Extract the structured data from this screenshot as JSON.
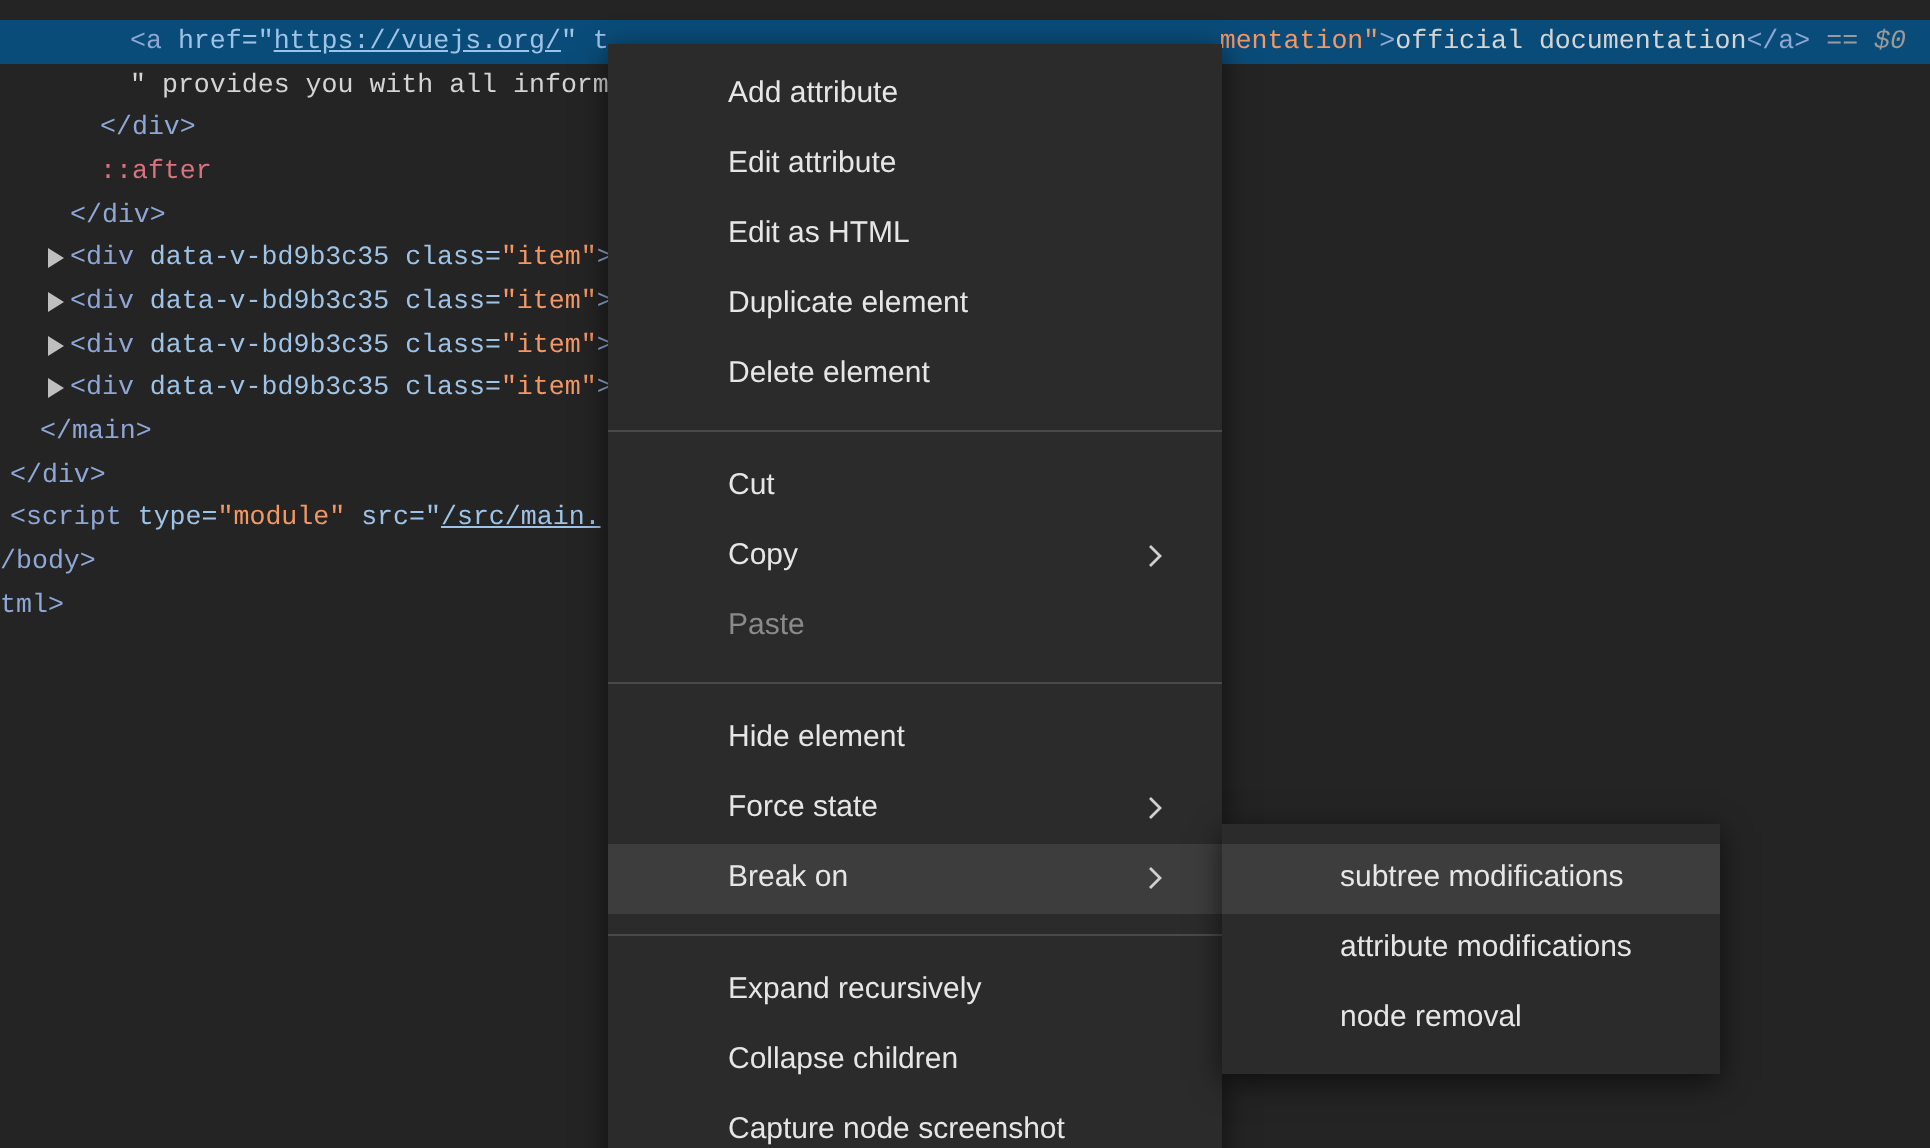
{
  "dom_tree": [
    {
      "kind": "group",
      "children": [
        {
          "kind": "group",
          "children": [
            {
              "kind": "group",
              "children": [
                {
                  "kind": "group",
                  "children": [
                    {
                      "kind": "group",
                      "children": [
                        {
                          "kind": "group",
                          "children": [
                            {
                              "kind": "row",
                              "selected": true,
                              "tokens": [
                                {
                                  "kind": "tag",
                                  "text": "<a"
                                },
                                {
                                  "kind": "attr",
                                  "text": " href=\""
                                },
                                {
                                  "kind": "link",
                                  "text": "https://vuejs.org/"
                                },
                                {
                                  "kind": "attr",
                                  "text": "\" t"
                                }
                              ],
                              "tokens_right": [
                                {
                                  "kind": "value",
                                  "text": "mentation\""
                                },
                                {
                                  "kind": "tag",
                                  "text": ">"
                                },
                                {
                                  "kind": "text",
                                  "text": "official documentation"
                                },
                                {
                                  "kind": "tag",
                                  "text": "</a>"
                                },
                                {
                                  "kind": "hint",
                                  "text": " == $0"
                                }
                              ]
                            },
                            {
                              "kind": "row",
                              "selected": false,
                              "tokens": [
                                {
                                  "kind": "text",
                                  "text": "\" provides you with all inform"
                                }
                              ]
                            }
                          ]
                        },
                        {
                          "kind": "row",
                          "selected": false,
                          "tokens": [
                            {
                              "kind": "tag",
                              "text": "</div>"
                            }
                          ]
                        },
                        {
                          "kind": "row",
                          "selected": false,
                          "tokens": [
                            {
                              "kind": "pseudo",
                              "text": "::after"
                            }
                          ]
                        }
                      ]
                    },
                    {
                      "kind": "row",
                      "selected": false,
                      "tokens": [
                        {
                          "kind": "tag",
                          "text": "</div>"
                        }
                      ]
                    },
                    {
                      "kind": "row",
                      "selected": false,
                      "collapsed": true,
                      "tokens": [
                        {
                          "kind": "tag",
                          "text": "<div"
                        },
                        {
                          "kind": "attr",
                          "text": " data-v-bd9b3c35 class="
                        },
                        {
                          "kind": "value",
                          "text": "\"item\""
                        },
                        {
                          "kind": "tag",
                          "text": ">"
                        }
                      ]
                    },
                    {
                      "kind": "row",
                      "selected": false,
                      "collapsed": true,
                      "tokens": [
                        {
                          "kind": "tag",
                          "text": "<div"
                        },
                        {
                          "kind": "attr",
                          "text": " data-v-bd9b3c35 class="
                        },
                        {
                          "kind": "value",
                          "text": "\"item\""
                        },
                        {
                          "kind": "tag",
                          "text": ">"
                        }
                      ]
                    },
                    {
                      "kind": "row",
                      "selected": false,
                      "collapsed": true,
                      "tokens": [
                        {
                          "kind": "tag",
                          "text": "<div"
                        },
                        {
                          "kind": "attr",
                          "text": " data-v-bd9b3c35 class="
                        },
                        {
                          "kind": "value",
                          "text": "\"item\""
                        },
                        {
                          "kind": "tag",
                          "text": ">"
                        }
                      ]
                    },
                    {
                      "kind": "row",
                      "selected": false,
                      "collapsed": true,
                      "tokens": [
                        {
                          "kind": "tag",
                          "text": "<div"
                        },
                        {
                          "kind": "attr",
                          "text": " data-v-bd9b3c35 class="
                        },
                        {
                          "kind": "value",
                          "text": "\"item\""
                        },
                        {
                          "kind": "tag",
                          "text": ">"
                        }
                      ]
                    }
                  ]
                },
                {
                  "kind": "row",
                  "selected": false,
                  "tokens": [
                    {
                      "kind": "tag",
                      "text": "</main>"
                    }
                  ]
                }
              ]
            },
            {
              "kind": "row",
              "selected": false,
              "tokens": [
                {
                  "kind": "tag",
                  "text": "</div>"
                }
              ]
            },
            {
              "kind": "row",
              "selected": false,
              "tokens": [
                {
                  "kind": "tag",
                  "text": "<script"
                },
                {
                  "kind": "attr",
                  "text": " type="
                },
                {
                  "kind": "value",
                  "text": "\"module\""
                },
                {
                  "kind": "attr",
                  "text": " src=\""
                },
                {
                  "kind": "link",
                  "text": "/src/main."
                }
              ]
            }
          ]
        },
        {
          "kind": "row",
          "selected": false,
          "tokens": [
            {
              "kind": "tag",
              "text": "/body>"
            }
          ]
        }
      ]
    },
    {
      "kind": "row",
      "selected": false,
      "tokens": [
        {
          "kind": "tag",
          "text": "tml>"
        }
      ]
    }
  ],
  "context_menu": {
    "sections": [
      [
        {
          "label": "Add attribute",
          "disabled": false,
          "has_submenu": false,
          "selected": false
        },
        {
          "label": "Edit attribute",
          "disabled": false,
          "has_submenu": false,
          "selected": false
        },
        {
          "label": "Edit as HTML",
          "disabled": false,
          "has_submenu": false,
          "selected": false
        },
        {
          "label": "Duplicate element",
          "disabled": false,
          "has_submenu": false,
          "selected": false
        },
        {
          "label": "Delete element",
          "disabled": false,
          "has_submenu": false,
          "selected": false
        }
      ],
      [
        {
          "label": "Cut",
          "disabled": false,
          "has_submenu": false,
          "selected": false
        },
        {
          "label": "Copy",
          "disabled": false,
          "has_submenu": true,
          "selected": false
        },
        {
          "label": "Paste",
          "disabled": true,
          "has_submenu": false,
          "selected": false
        }
      ],
      [
        {
          "label": "Hide element",
          "disabled": false,
          "has_submenu": false,
          "selected": false
        },
        {
          "label": "Force state",
          "disabled": false,
          "has_submenu": true,
          "selected": false
        },
        {
          "label": "Break on",
          "disabled": false,
          "has_submenu": true,
          "selected": true
        }
      ],
      [
        {
          "label": "Expand recursively",
          "disabled": false,
          "has_submenu": false,
          "selected": false
        },
        {
          "label": "Collapse children",
          "disabled": false,
          "has_submenu": false,
          "selected": false
        },
        {
          "label": "Capture node screenshot",
          "disabled": false,
          "has_submenu": false,
          "selected": false
        }
      ]
    ]
  },
  "submenu": {
    "items": [
      {
        "label": "subtree modifications",
        "selected": true
      },
      {
        "label": "attribute modifications",
        "selected": false
      },
      {
        "label": "node removal",
        "selected": false
      }
    ]
  }
}
